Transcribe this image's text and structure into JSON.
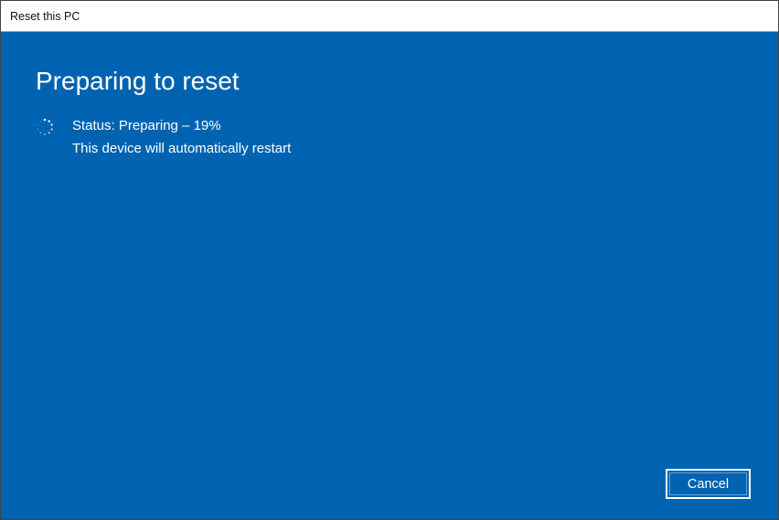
{
  "titlebar": {
    "title": "Reset this PC"
  },
  "main": {
    "heading": "Preparing to reset",
    "status_prefix": "Status: ",
    "status_state": "Preparing",
    "status_separator": " – ",
    "status_percent": "19%",
    "subtext": "This device will automatically restart"
  },
  "footer": {
    "cancel_label": "Cancel"
  },
  "colors": {
    "background": "#0063b1",
    "text": "#ffffff"
  }
}
